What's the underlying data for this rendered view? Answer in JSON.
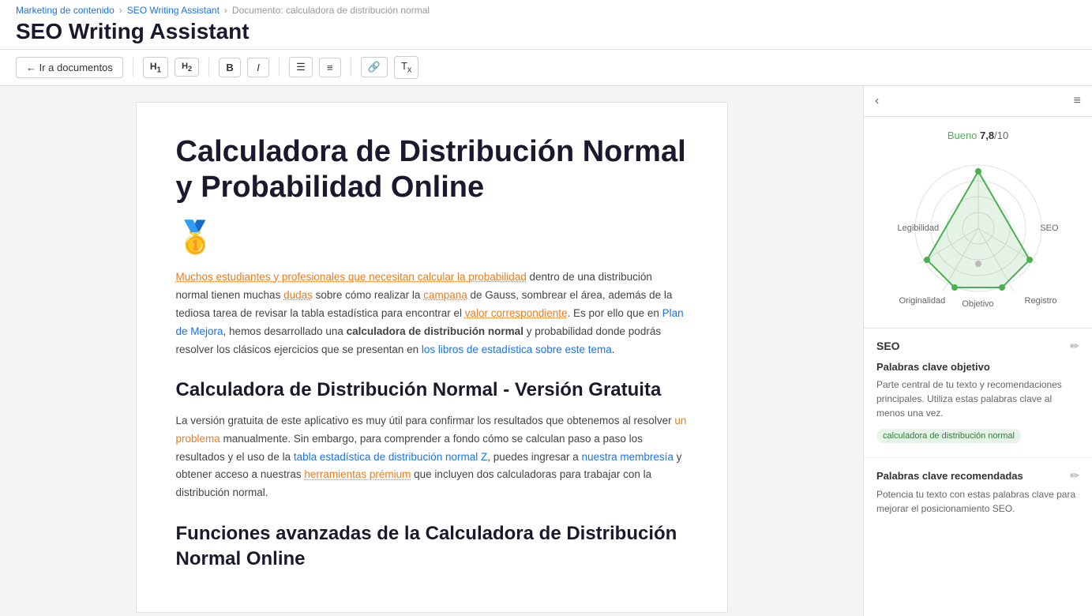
{
  "breadcrumb": {
    "item1": "Marketing de contenido",
    "item2": "SEO Writing Assistant",
    "item3": "Documento: calculadora de distribución normal"
  },
  "page": {
    "title": "SEO Writing Assistant"
  },
  "toolbar": {
    "back_button": "← Ir a documentos",
    "h1": "H₁",
    "h2": "H₂",
    "bold": "B",
    "italic": "I",
    "list_ul": "≡",
    "list_ol": "≡",
    "link": "🔗",
    "clear": "Tx"
  },
  "editor": {
    "title": "Calculadora de Distribución Normal y Probabilidad Online",
    "medal_emoji": "🥇",
    "intro": "Muchos estudiantes y profesionales que necesitan calcular la probabilidad dentro de una distribución normal tienen muchas dudas sobre cómo realizar la campana de Gauss, sombrear el área, además de la tediosa tarea de revisar la tabla estadística para encontrar el valor correspondiente. Es por ello que en Plan de Mejora, hemos desarrollado una calculadora de distribución normal y probabilidad donde podrás resolver los clásicos ejercicios que se presentan en los libros de estadística sobre este tema.",
    "section1_title": "Calculadora de Distribución Normal - Versión Gratuita",
    "section1_text": "La versión gratuita de este aplicativo es muy útil para confirmar los resultados que obtenemos al resolver un problema manualmente. Sin embargo, para comprender a fondo cómo se calculan paso a paso los resultados y el uso de la tabla estadística de distribución normal Z, puedes ingresar a nuestra membresía y obtener acceso a nuestras herramientas prémium que incluyen dos calculadoras para trabajar con la distribución normal.",
    "section2_title": "Funciones avanzadas de la Calculadora de Distribución Normal Online"
  },
  "panel": {
    "score_label": "Bueno",
    "score_value": "7,8",
    "score_total": "/10",
    "radar_labels": {
      "legibilidad": "Legibilidad",
      "seo": "SEO",
      "originalidad": "Originalidad",
      "registro": "Registro",
      "objetivo": "Objetivo"
    },
    "seo_title": "SEO",
    "keywords_title": "Palabras clave objetivo",
    "keywords_desc": "Parte central de tu texto y recomendaciones principales. Utiliza estas palabras clave al menos una vez.",
    "keyword_badge": "calculadora de distribución normal",
    "recommended_title": "Palabras clave recomendadas",
    "recommended_desc": "Potencia tu texto con estas palabras clave para mejorar el posicionamiento SEO."
  }
}
